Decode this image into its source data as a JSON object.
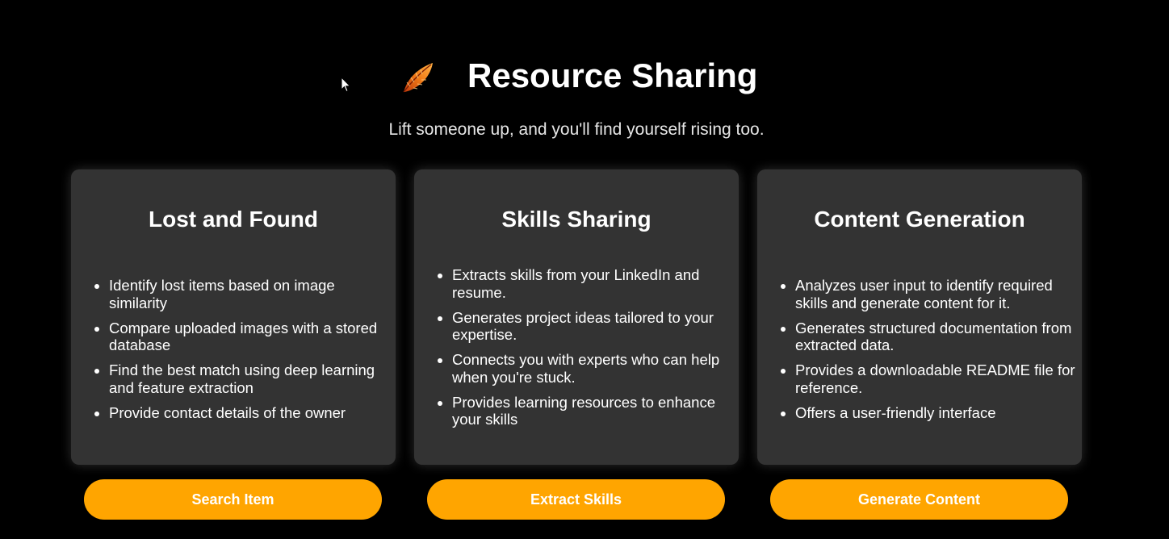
{
  "header": {
    "logo_icon": "feather-icon",
    "title": "Resource Sharing",
    "subtitle": "Lift someone up, and you'll find yourself rising too."
  },
  "cards": [
    {
      "title": "Lost and Found",
      "items": [
        "Identify lost items based on image similarity",
        "Compare uploaded images with a stored database",
        "Find the best match using deep learning and feature extraction",
        "Provide contact details of the owner"
      ],
      "button_label": "Search Item"
    },
    {
      "title": "Skills Sharing",
      "items": [
        "Extracts skills from your LinkedIn and resume.",
        "Generates project ideas tailored to your expertise.",
        "Connects you with experts who can help when you're stuck.",
        "Provides learning resources to enhance your skills"
      ],
      "button_label": "Extract Skills"
    },
    {
      "title": "Content Generation",
      "items": [
        "Analyzes user input to identify required skills and generate content for it.",
        "Generates structured documentation from extracted data.",
        "Provides a downloadable README file for reference.",
        "Offers a user-friendly interface"
      ],
      "button_label": "Generate Content"
    }
  ],
  "colors": {
    "background": "#000000",
    "card": "#333333",
    "accent": "#ffa500",
    "text": "#ffffff"
  }
}
